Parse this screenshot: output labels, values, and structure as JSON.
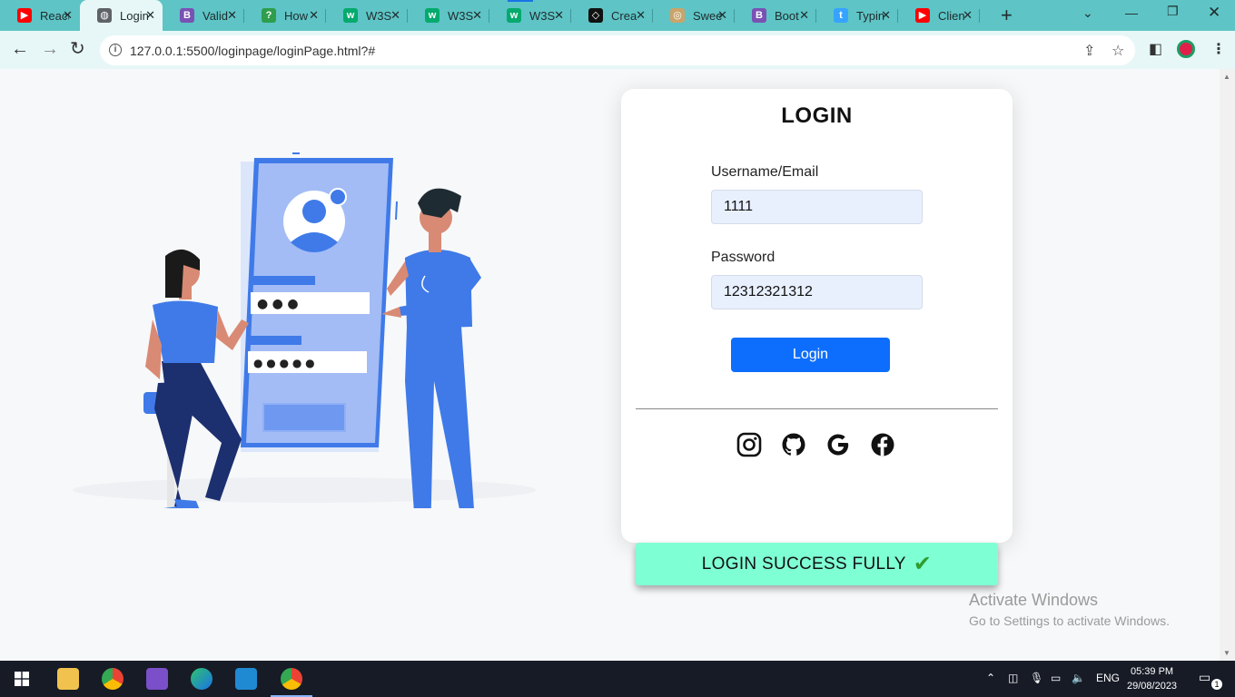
{
  "browser": {
    "tabs": [
      {
        "title": "React",
        "icon": "youtube-icon",
        "color": "#ff0000"
      },
      {
        "title": "Login",
        "icon": "globe-icon",
        "color": "#5f6368",
        "active": true
      },
      {
        "title": "Valid",
        "icon": "bootstrap-icon",
        "color": "#7952b3"
      },
      {
        "title": "How",
        "icon": "stack-icon",
        "color": "#2e9d4c"
      },
      {
        "title": "W3S",
        "icon": "w3schools-icon",
        "color": "#04aa6d"
      },
      {
        "title": "W3S",
        "icon": "w3schools-icon",
        "color": "#04aa6d"
      },
      {
        "title": "W3S",
        "icon": "w3schools-icon",
        "color": "#04aa6d",
        "loading": true
      },
      {
        "title": "Crea",
        "icon": "codepen-icon",
        "color": "#111111"
      },
      {
        "title": "Swee",
        "icon": "sweetalert-icon",
        "color": "#c9a46a"
      },
      {
        "title": "Boot",
        "icon": "bootstrap-icon",
        "color": "#7952b3"
      },
      {
        "title": "Typin",
        "icon": "tumblr-icon",
        "color": "#36a4ff"
      },
      {
        "title": "Clien",
        "icon": "youtube-icon",
        "color": "#ff0000"
      }
    ],
    "url": "127.0.0.1:5500/loginpage/loginPage.html?#"
  },
  "login": {
    "title": "LOGIN",
    "username_label": "Username/Email",
    "username_value": "1111",
    "password_label": "Password",
    "password_value": "12312321312",
    "button": "Login"
  },
  "illustration": {
    "password_dots_1": "● ● ●",
    "password_dots_2": "● ● ● ● ●"
  },
  "social": [
    "instagram-icon",
    "github-icon",
    "google-icon",
    "facebook-icon"
  ],
  "toast": {
    "message": "LOGIN SUCCESS FULLY",
    "icon": "check-icon",
    "background": "#7fffd4"
  },
  "watermark": {
    "line1": "Activate Windows",
    "line2": "Go to Settings to activate Windows."
  },
  "taskbar": {
    "language": "ENG",
    "time": "05:39 PM",
    "date": "29/08/2023",
    "notifications": "1"
  },
  "colors": {
    "tabbar": "#5ec4c6",
    "primary_button": "#0d6efd",
    "input_background": "#e8f0fe",
    "illustration_blue": "#3f7ae8"
  }
}
